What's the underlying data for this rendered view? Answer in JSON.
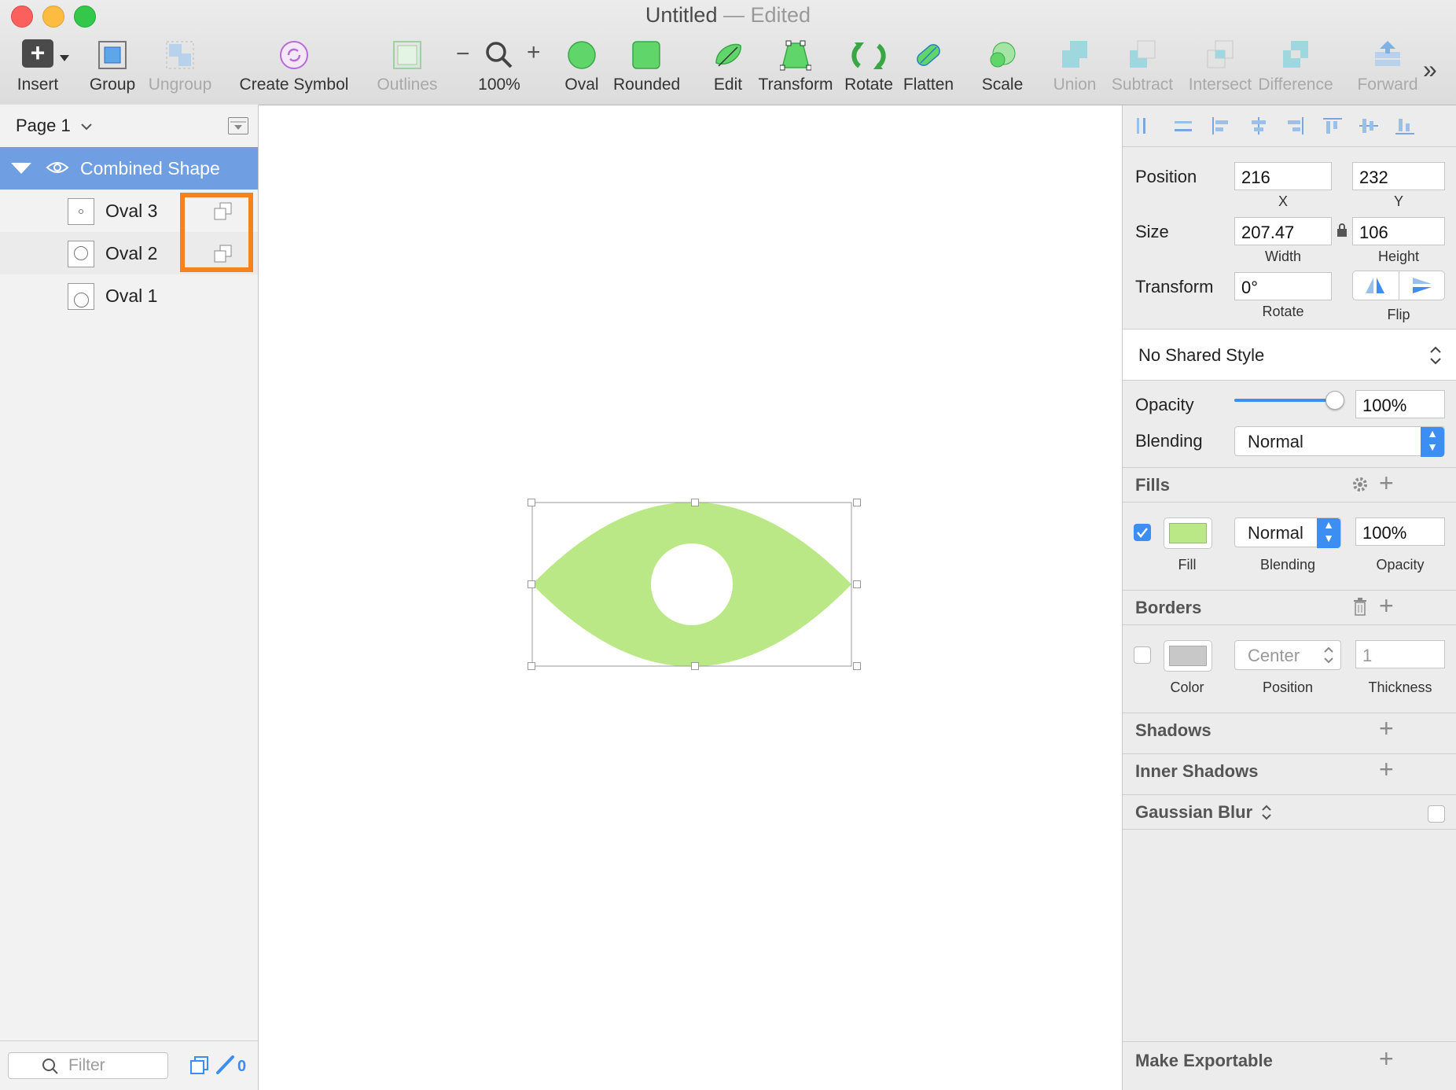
{
  "window": {
    "title": "Untitled",
    "separator": "—",
    "status": "Edited"
  },
  "toolbar": {
    "items": [
      {
        "label": "Insert"
      },
      {
        "label": "Group"
      },
      {
        "label": "Ungroup"
      },
      {
        "label": "Create Symbol"
      },
      {
        "label": "Outlines"
      },
      {
        "label": "100%"
      },
      {
        "label": "Oval"
      },
      {
        "label": "Rounded"
      },
      {
        "label": "Edit"
      },
      {
        "label": "Transform"
      },
      {
        "label": "Rotate"
      },
      {
        "label": "Flatten"
      },
      {
        "label": "Scale"
      },
      {
        "label": "Union"
      },
      {
        "label": "Subtract"
      },
      {
        "label": "Intersect"
      },
      {
        "label": "Difference"
      },
      {
        "label": "Forward"
      }
    ],
    "zoom_minus": "−",
    "zoom_plus": "+",
    "more": "»"
  },
  "sidebar": {
    "page": "Page 1",
    "group": "Combined Shape",
    "layers": [
      {
        "name": "Oval 3"
      },
      {
        "name": "Oval 2"
      },
      {
        "name": "Oval 1"
      }
    ],
    "filter_placeholder": "Filter",
    "edited_count": "0"
  },
  "canvas": {
    "shape_color": "#bbe886"
  },
  "inspector": {
    "position": {
      "label": "Position",
      "x": "216",
      "y": "232",
      "x_label": "X",
      "y_label": "Y"
    },
    "size": {
      "label": "Size",
      "width": "207.47",
      "height": "106",
      "w_label": "Width",
      "h_label": "Height"
    },
    "transform": {
      "label": "Transform",
      "rotate": "0°",
      "rotate_label": "Rotate",
      "flip_label": "Flip"
    },
    "shared_style": "No Shared Style",
    "opacity": {
      "label": "Opacity",
      "value": "100%",
      "level": 1.0
    },
    "blending": {
      "label": "Blending",
      "value": "Normal"
    },
    "fills": {
      "title": "Fills",
      "checked": true,
      "color": "#bbe886",
      "blending": "Normal",
      "opacity": "100%",
      "fill_label": "Fill",
      "blending_label": "Blending",
      "opacity_label": "Opacity"
    },
    "borders": {
      "title": "Borders",
      "checked": false,
      "color": "#c8c8c8",
      "position": "Center",
      "thickness": "1",
      "color_label": "Color",
      "position_label": "Position",
      "thickness_label": "Thickness"
    },
    "shadows": "Shadows",
    "inner_shadows": "Inner Shadows",
    "blur": "Gaussian Blur",
    "exportable": "Make Exportable"
  },
  "colors": {
    "accent": "#3d8ef2",
    "selection": "#6f9fe2",
    "highlight": "#f5821f"
  }
}
